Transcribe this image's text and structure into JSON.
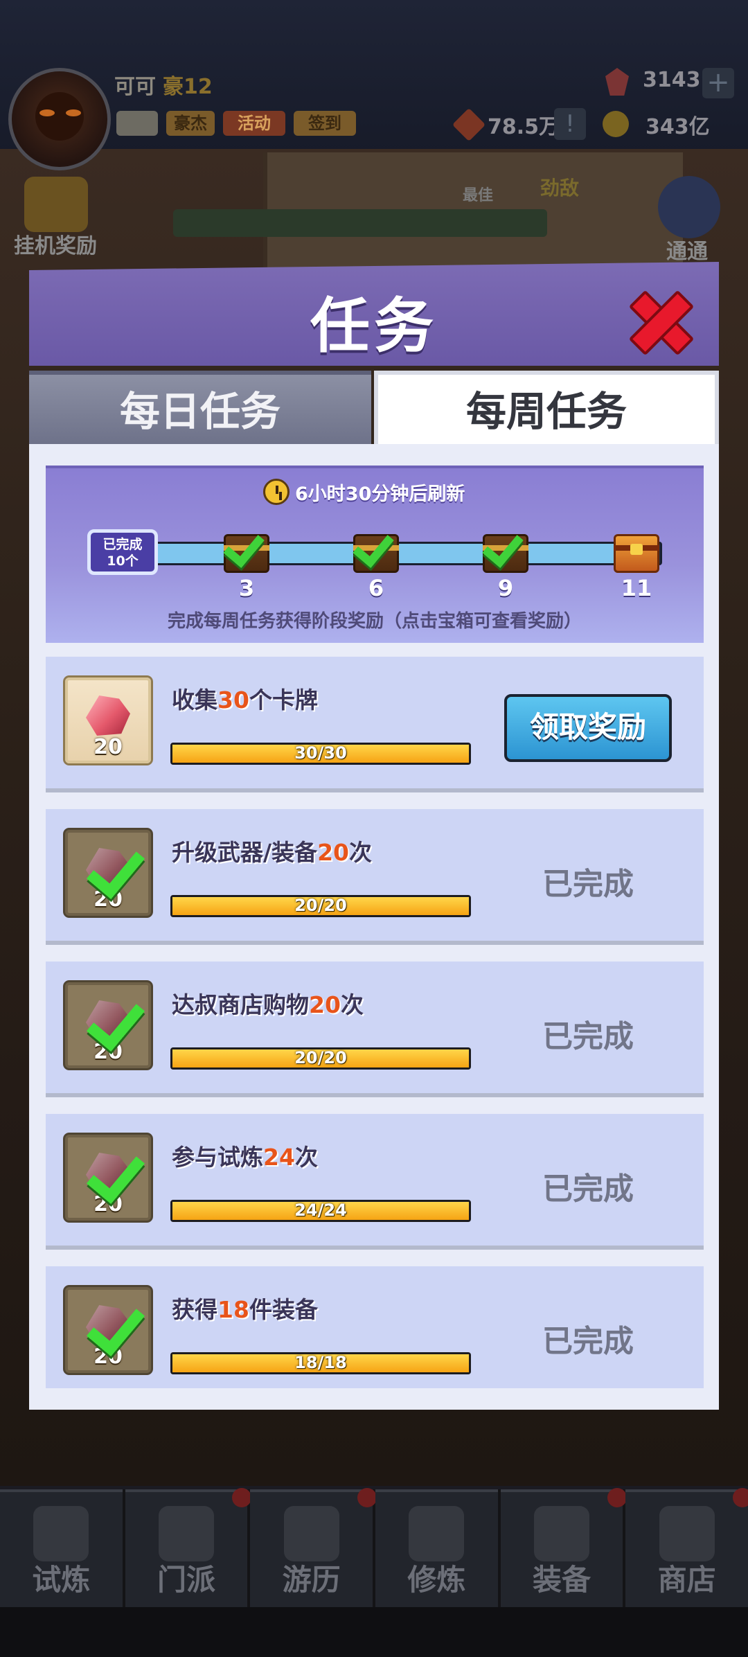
{
  "hud": {
    "player_name": "可可",
    "player_rank": "豪12",
    "buttons": {
      "hero": "豪杰",
      "event": "活动",
      "sign_in": "签到"
    },
    "currency": {
      "gems": "3143",
      "power": "78.5万",
      "gold": "343亿"
    },
    "afk_reward": "挂机奖励",
    "best": "最佳",
    "enemy": "劲敌",
    "clear": "通通"
  },
  "modal": {
    "title": "任务",
    "tabs": [
      {
        "label": "每日任务",
        "active": false
      },
      {
        "label": "每周任务",
        "active": true
      }
    ],
    "refresh_text": "6小时30分钟后刷新",
    "completed_badge": {
      "line1": "已完成",
      "line2": "10个"
    },
    "progress": {
      "completed": 10,
      "max": 11
    },
    "milestones": [
      {
        "label": "3",
        "claimed": true
      },
      {
        "label": "6",
        "claimed": true
      },
      {
        "label": "9",
        "claimed": true
      },
      {
        "label": "11",
        "claimed": false
      }
    ],
    "stage_hint": "完成每周任务获得阶段奖励（点击宝箱可查看奖励）",
    "claim_label": "领取奖励",
    "done_label": "已完成",
    "tasks": [
      {
        "pre": "收集",
        "num": "30",
        "post": "个卡牌",
        "reward": "20",
        "progress": "30/30",
        "fill": 1.0,
        "state": "claimable"
      },
      {
        "pre": "升级武器/装备",
        "num": "20",
        "post": "次",
        "reward": "20",
        "progress": "20/20",
        "fill": 1.0,
        "state": "done"
      },
      {
        "pre": "达叔商店购物",
        "num": "20",
        "post": "次",
        "reward": "20",
        "progress": "20/20",
        "fill": 1.0,
        "state": "done"
      },
      {
        "pre": "参与试炼",
        "num": "24",
        "post": "次",
        "reward": "20",
        "progress": "24/24",
        "fill": 1.0,
        "state": "done"
      },
      {
        "pre": "获得",
        "num": "18",
        "post": "件装备",
        "reward": "20",
        "progress": "18/18",
        "fill": 1.0,
        "state": "done"
      }
    ]
  },
  "bottom_nav": [
    {
      "label": "试炼",
      "dot": false
    },
    {
      "label": "门派",
      "dot": true
    },
    {
      "label": "游历",
      "dot": true
    },
    {
      "label": "修炼",
      "dot": false
    },
    {
      "label": "装备",
      "dot": true
    },
    {
      "label": "商店",
      "dot": true
    }
  ],
  "colors": {
    "header": "#7465b0",
    "panel": "#e9ecf8",
    "task_bg": "#cdd5f5",
    "claim_button": "#3aa6dd",
    "highlight_number": "#e8541a",
    "progress_fill": "#f6b520"
  }
}
